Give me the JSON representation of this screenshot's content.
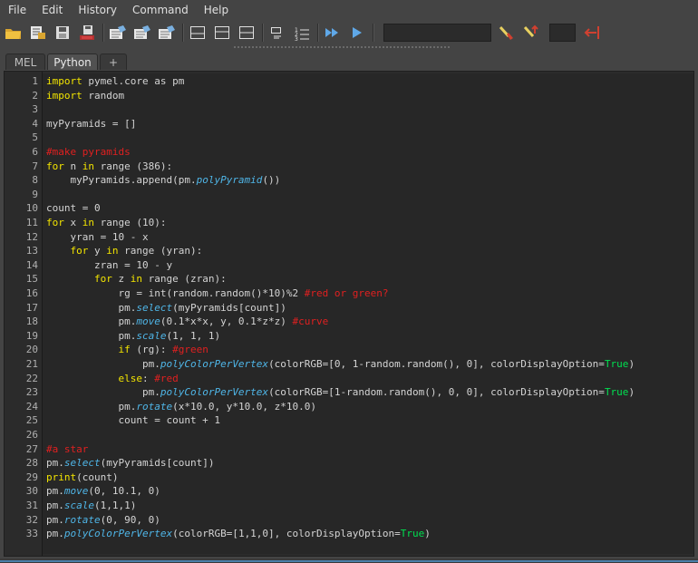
{
  "menu": [
    "File",
    "Edit",
    "History",
    "Command",
    "Help"
  ],
  "tabs": [
    "MEL",
    "Python",
    "+"
  ],
  "active_tab": "Python",
  "editor": {
    "line_numbers": [
      "1",
      "2",
      "3",
      "4",
      "5",
      "6",
      "7",
      "8",
      "9",
      "10",
      "11",
      "12",
      "13",
      "14",
      "15",
      "16",
      "17",
      "18",
      "19",
      "20",
      "21",
      "22",
      "23",
      "24",
      "25",
      "26",
      "27",
      "28",
      "29",
      "30",
      "31",
      "32",
      "33"
    ],
    "lines": [
      [
        [
          "kw",
          "import"
        ],
        [
          "p",
          " pymel.core as pm"
        ]
      ],
      [
        [
          "kw",
          "import"
        ],
        [
          "p",
          " random"
        ]
      ],
      [],
      [
        [
          "p",
          "myPyramids = []"
        ]
      ],
      [],
      [
        [
          "cm",
          "#make pyramids"
        ]
      ],
      [
        [
          "kw",
          "for"
        ],
        [
          "p",
          " n "
        ],
        [
          "kw",
          "in"
        ],
        [
          "p",
          " range (386):"
        ]
      ],
      [
        [
          "p",
          "    myPyramids.append(pm."
        ],
        [
          "fn",
          "polyPyramid"
        ],
        [
          "p",
          "())"
        ]
      ],
      [],
      [
        [
          "p",
          "count = 0"
        ]
      ],
      [
        [
          "kw",
          "for"
        ],
        [
          "p",
          " x "
        ],
        [
          "kw",
          "in"
        ],
        [
          "p",
          " range (10):"
        ]
      ],
      [
        [
          "p",
          "    yran = 10 - x"
        ]
      ],
      [
        [
          "p",
          "    "
        ],
        [
          "kw",
          "for"
        ],
        [
          "p",
          " y "
        ],
        [
          "kw",
          "in"
        ],
        [
          "p",
          " range (yran):"
        ]
      ],
      [
        [
          "p",
          "        zran = 10 - y"
        ]
      ],
      [
        [
          "p",
          "        "
        ],
        [
          "kw",
          "for"
        ],
        [
          "p",
          " z "
        ],
        [
          "kw",
          "in"
        ],
        [
          "p",
          " range (zran):"
        ]
      ],
      [
        [
          "p",
          "            rg = int(random.random()*10)%2 "
        ],
        [
          "cm",
          "#red or green?"
        ]
      ],
      [
        [
          "p",
          "            pm."
        ],
        [
          "fn",
          "select"
        ],
        [
          "p",
          "(myPyramids[count])"
        ]
      ],
      [
        [
          "p",
          "            pm."
        ],
        [
          "fn",
          "move"
        ],
        [
          "p",
          "(0.1*x*x, y, 0.1*z*z) "
        ],
        [
          "cm",
          "#curve"
        ]
      ],
      [
        [
          "p",
          "            pm."
        ],
        [
          "fn",
          "scale"
        ],
        [
          "p",
          "(1, 1, 1)"
        ]
      ],
      [
        [
          "p",
          "            "
        ],
        [
          "kw",
          "if"
        ],
        [
          "p",
          " (rg): "
        ],
        [
          "cm",
          "#green"
        ]
      ],
      [
        [
          "p",
          "                pm."
        ],
        [
          "fn",
          "polyColorPerVertex"
        ],
        [
          "p",
          "(colorRGB=[0, 1-random.random(), 0], colorDisplayOption="
        ],
        [
          "tr",
          "True"
        ],
        [
          "p",
          ")"
        ]
      ],
      [
        [
          "p",
          "            "
        ],
        [
          "kw",
          "else"
        ],
        [
          "p",
          ": "
        ],
        [
          "cm",
          "#red"
        ]
      ],
      [
        [
          "p",
          "                pm."
        ],
        [
          "fn",
          "polyColorPerVertex"
        ],
        [
          "p",
          "(colorRGB=[1-random.random(), 0, 0], colorDisplayOption="
        ],
        [
          "tr",
          "True"
        ],
        [
          "p",
          ")"
        ]
      ],
      [
        [
          "p",
          "            pm."
        ],
        [
          "fn",
          "rotate"
        ],
        [
          "p",
          "(x*10.0, y*10.0, z*10.0)"
        ]
      ],
      [
        [
          "p",
          "            count = count + 1"
        ]
      ],
      [],
      [
        [
          "cm",
          "#a star"
        ]
      ],
      [
        [
          "p",
          "pm."
        ],
        [
          "fn",
          "select"
        ],
        [
          "p",
          "(myPyramids[count])"
        ]
      ],
      [
        [
          "kw",
          "print"
        ],
        [
          "p",
          "(count)"
        ]
      ],
      [
        [
          "p",
          "pm."
        ],
        [
          "fn",
          "move"
        ],
        [
          "p",
          "(0, 10.1, 0)"
        ]
      ],
      [
        [
          "p",
          "pm."
        ],
        [
          "fn",
          "scale"
        ],
        [
          "p",
          "(1,1,1)"
        ]
      ],
      [
        [
          "p",
          "pm."
        ],
        [
          "fn",
          "rotate"
        ],
        [
          "p",
          "(0, 90, 0)"
        ]
      ],
      [
        [
          "p",
          "pm."
        ],
        [
          "fn",
          "polyColorPerVertex"
        ],
        [
          "p",
          "(colorRGB=[1,1,0], colorDisplayOption="
        ],
        [
          "tr",
          "True"
        ],
        [
          "p",
          ")"
        ]
      ]
    ]
  },
  "toolbar_icons": [
    "open-script-icon",
    "source-script-icon",
    "save-script-icon",
    "save-to-shelf-icon",
    "clear-history-icon",
    "clear-input-icon",
    "clear-all-icon",
    "show-history-icon",
    "show-input-icon",
    "show-both-icon",
    "echo-commands-icon",
    "line-numbers-icon",
    "execute-all-icon",
    "execute-selected-icon",
    "show-tooltip-icon",
    "pin-icon",
    "close-panel-icon"
  ],
  "colors": {
    "keyword": "#f2e400",
    "function": "#4fb6e8",
    "comment": "#e02020",
    "boolean": "#00e050",
    "plain": "#d4d4d4",
    "editor_bg": "#272727",
    "ui_bg": "#444444"
  }
}
